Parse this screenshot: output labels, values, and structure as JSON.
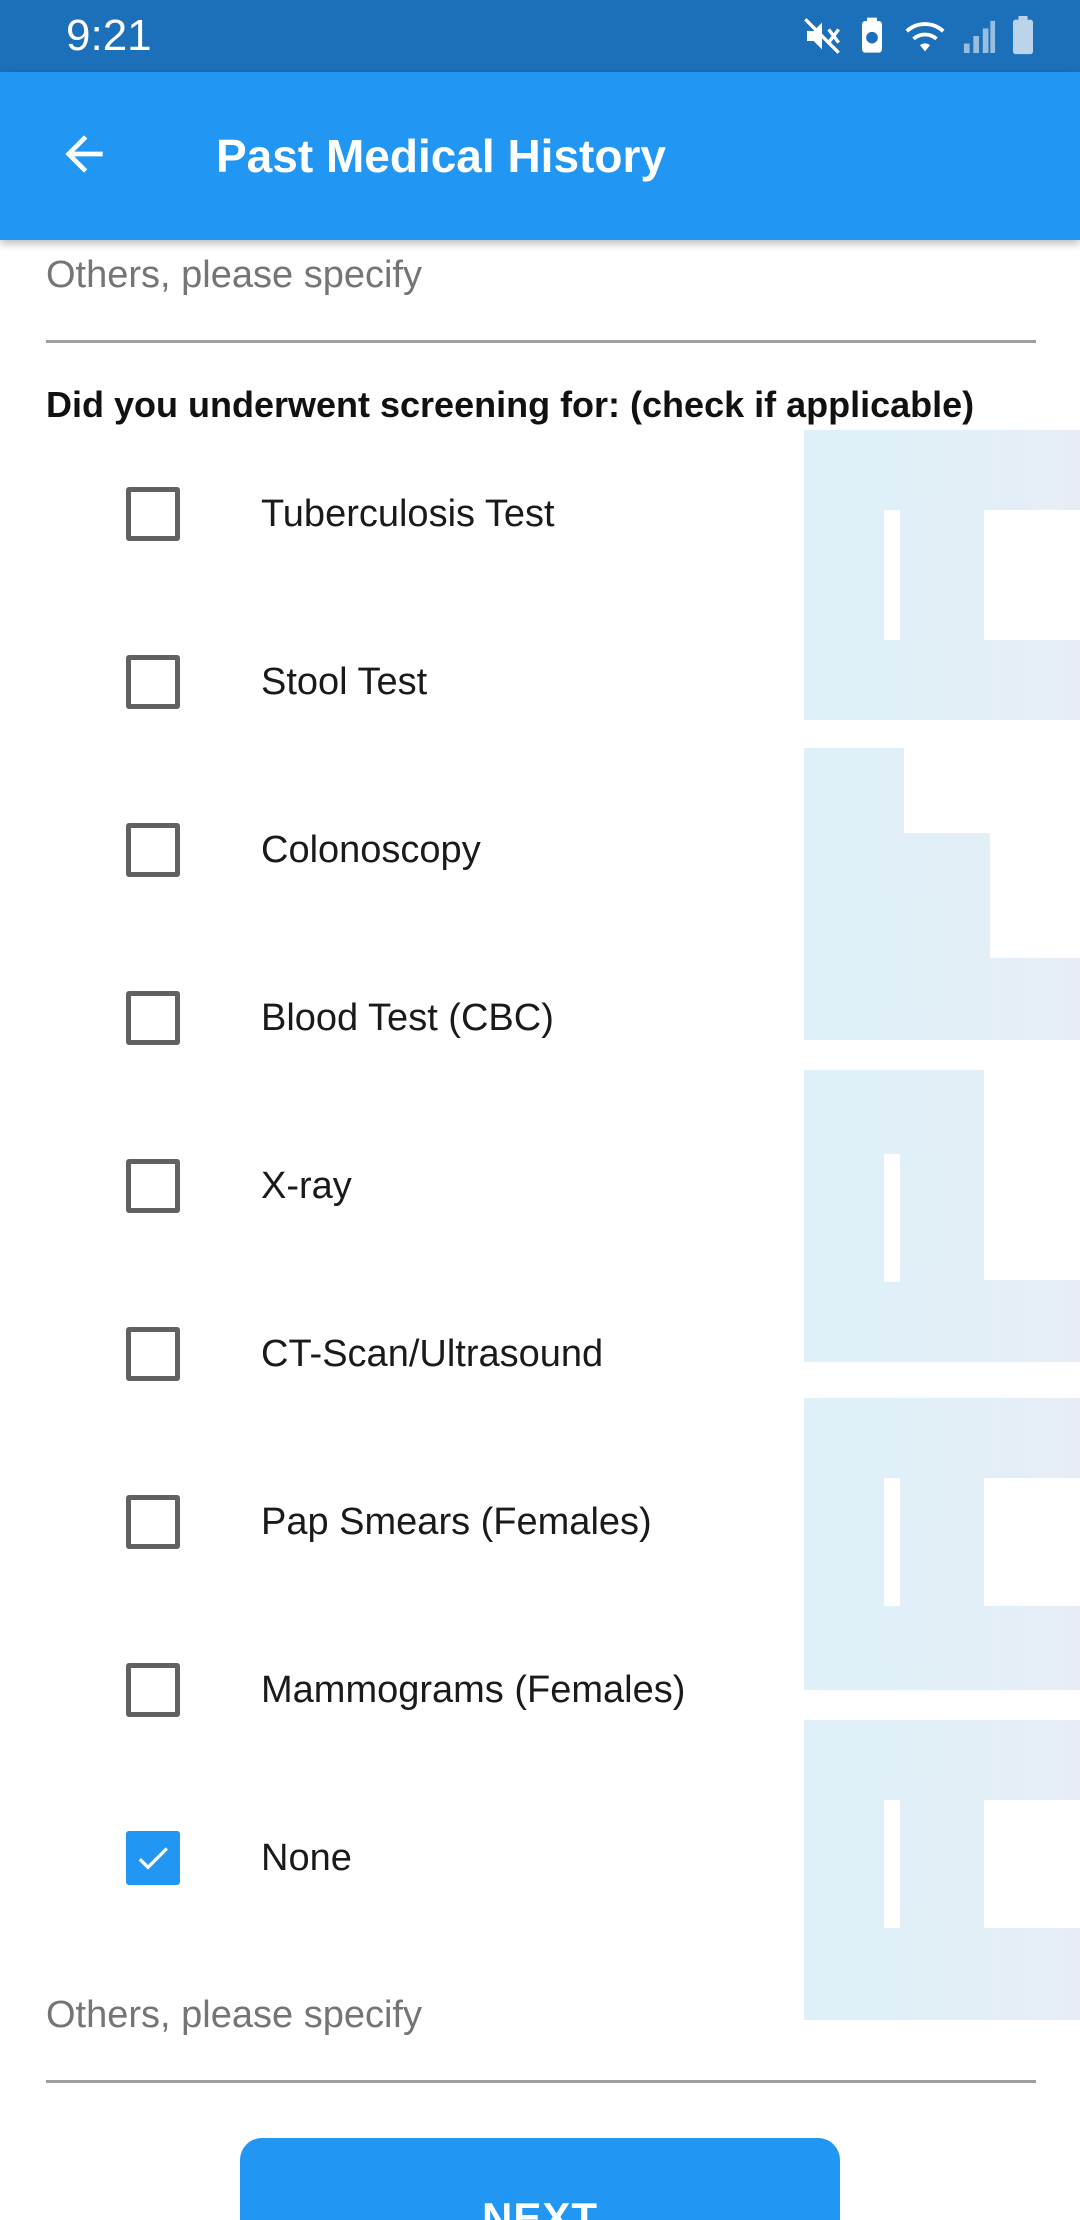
{
  "status_bar": {
    "time": "9:21",
    "icons": [
      "mute-icon",
      "battery-saver-icon",
      "wifi-icon",
      "signal-icon",
      "battery-icon"
    ]
  },
  "app_bar": {
    "back_icon": "arrow-left-icon",
    "title": "Past Medical History"
  },
  "form": {
    "others_top": {
      "placeholder": "Others, please specify",
      "value": ""
    },
    "question": "Did you underwent screening for: (check if applicable)",
    "options": [
      {
        "label": "Tuberculosis Test",
        "checked": false
      },
      {
        "label": "Stool Test",
        "checked": false
      },
      {
        "label": "Colonoscopy",
        "checked": false
      },
      {
        "label": "Blood Test (CBC)",
        "checked": false
      },
      {
        "label": "X-ray",
        "checked": false
      },
      {
        "label": "CT-Scan/Ultrasound",
        "checked": false
      },
      {
        "label": "Pap Smears (Females)",
        "checked": false
      },
      {
        "label": "Mammograms (Females)",
        "checked": false
      },
      {
        "label": "None",
        "checked": true
      }
    ],
    "others_bottom": {
      "placeholder": "Others, please specify",
      "value": ""
    },
    "next_label": "NEXT"
  },
  "colors": {
    "status_bar": "#1c6fb9",
    "app_bar": "#2196f3",
    "accent": "#2196f3",
    "checkbox_border": "#616161",
    "watermark": "#dff0f8"
  }
}
